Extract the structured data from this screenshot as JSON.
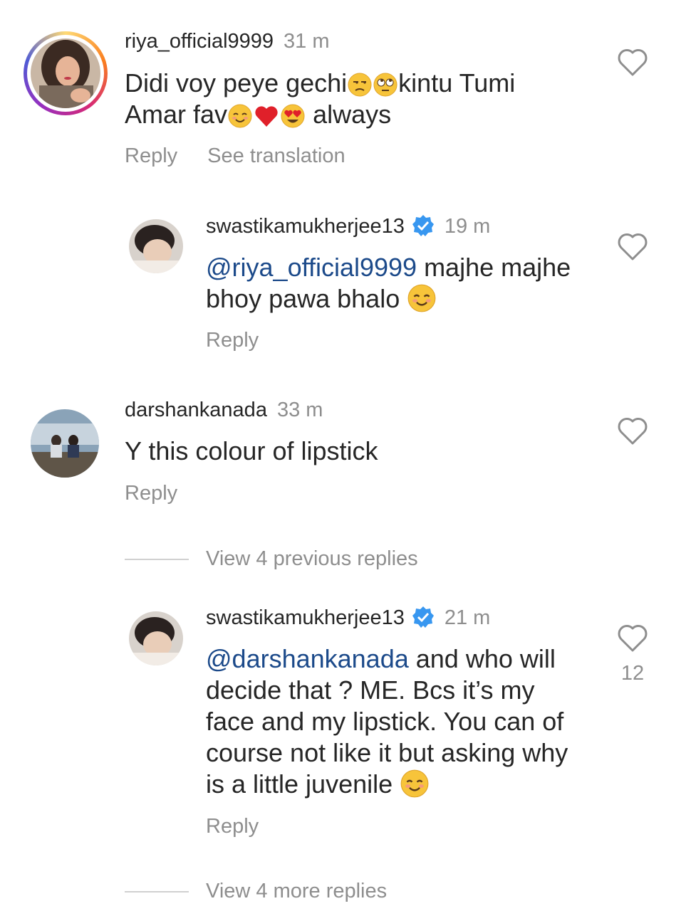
{
  "comments": [
    {
      "username": "riya_official9999",
      "time": "31 m",
      "text_line1": "Didi voy peye gechi",
      "text_line1_after": "kintu Tumi",
      "text_line2": "Amar fav",
      "text_line2_after": "always",
      "reply": "Reply",
      "translate": "See translation"
    },
    {
      "username": "swastikamukherjee13",
      "time": "19 m",
      "mention": "@riya_official9999",
      "text_line1_after": " majhe majhe",
      "text_line2": "bhoy pawa bhalo",
      "reply": "Reply"
    },
    {
      "username": "darshankanada",
      "time": "33 m",
      "text": "Y this colour of lipstick",
      "reply": "Reply"
    },
    {
      "username": "swastikamukherjee13",
      "time": "21 m",
      "mention": "@darshankanada",
      "text_line1_after": " and who will",
      "text_line2": "decide that ? ME. Bcs it’s my",
      "text_line3": "face and my lipstick. You can of",
      "text_line4": "course not like it but asking why",
      "text_line5": "is a little juvenile",
      "reply": "Reply",
      "likes": "12"
    }
  ],
  "view_previous": "View 4 previous replies",
  "view_more": "View 4 more replies",
  "colors": {
    "mention": "#1c4a8a",
    "secondary": "#8e8e8e",
    "verified": "#3897f0",
    "heart_outline": "#8e8e8e"
  }
}
